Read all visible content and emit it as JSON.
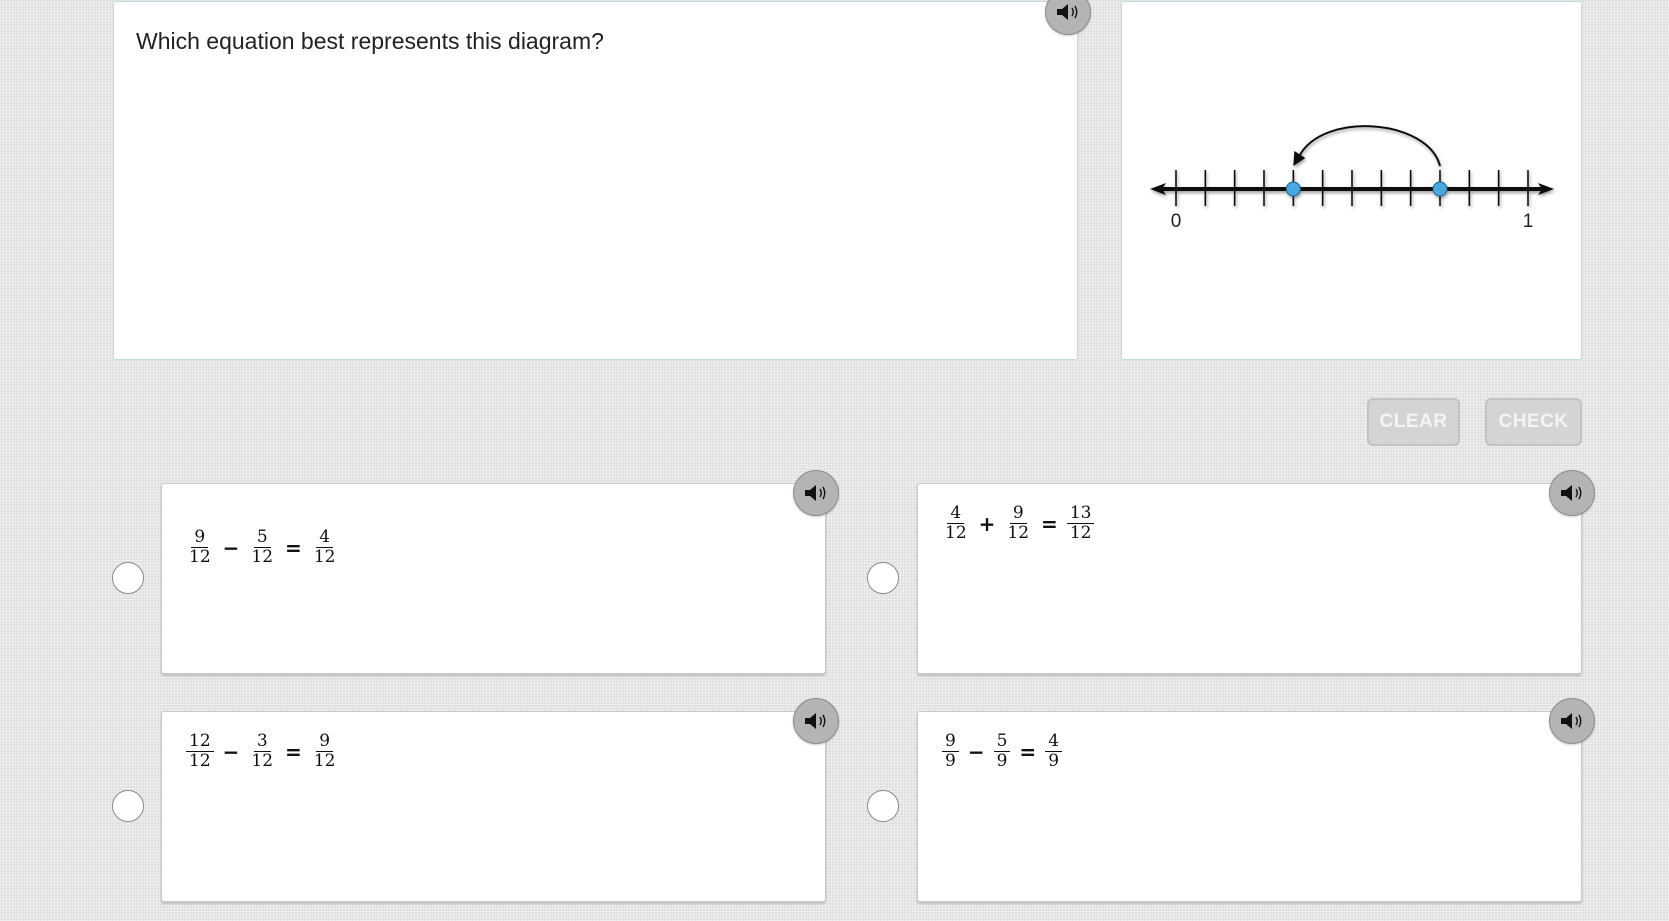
{
  "question": {
    "text": "Which equation best represents this diagram?",
    "speaker_icon": "speaker-icon"
  },
  "diagram": {
    "type": "number-line",
    "min_label": "0",
    "max_label": "1",
    "divisions": 12,
    "start_tick": 9,
    "end_tick": 4,
    "jump_direction": "left",
    "point_color": "#4aa8e0",
    "line_color": "#111111"
  },
  "buttons": {
    "clear_label": "CLEAR",
    "check_label": "CHECK"
  },
  "options": [
    {
      "id": "A",
      "terms": [
        {
          "num": "9",
          "den": "12"
        },
        {
          "op": "−"
        },
        {
          "num": "5",
          "den": "12"
        },
        {
          "op": "="
        },
        {
          "num": "4",
          "den": "12"
        }
      ],
      "selected": false
    },
    {
      "id": "B",
      "terms": [
        {
          "num": "4",
          "den": "12"
        },
        {
          "op": "+"
        },
        {
          "num": "9",
          "den": "12"
        },
        {
          "op": "="
        },
        {
          "num": "13",
          "den": "12"
        }
      ],
      "selected": false
    },
    {
      "id": "C",
      "terms": [
        {
          "num": "12",
          "den": "12"
        },
        {
          "op": "−"
        },
        {
          "num": "3",
          "den": "12"
        },
        {
          "op": "="
        },
        {
          "num": "9",
          "den": "12"
        }
      ],
      "selected": false
    },
    {
      "id": "D",
      "terms": [
        {
          "num": "9",
          "den": "9"
        },
        {
          "op": "−"
        },
        {
          "num": "5",
          "den": "9"
        },
        {
          "op": "="
        },
        {
          "num": "4",
          "den": "9"
        }
      ],
      "selected": false
    }
  ]
}
